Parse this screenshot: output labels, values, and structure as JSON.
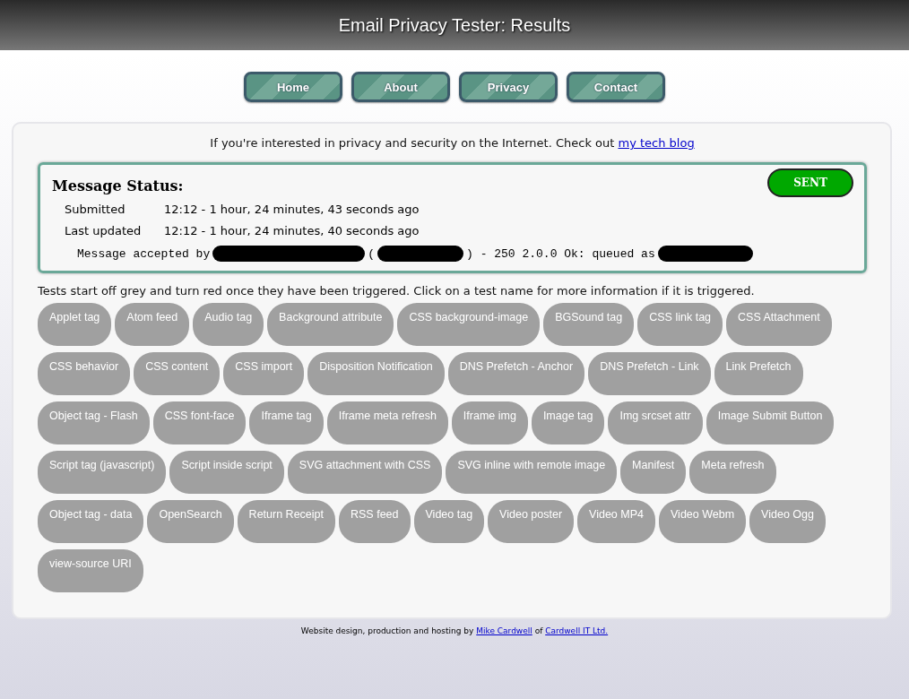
{
  "header": {
    "title": "Email Privacy Tester: Results"
  },
  "nav": [
    {
      "label": "Home"
    },
    {
      "label": "About"
    },
    {
      "label": "Privacy"
    },
    {
      "label": "Contact"
    }
  ],
  "intro": {
    "text": "If you're interested in privacy and security on the Internet. Check out",
    "link": "my tech blog"
  },
  "status": {
    "title": "Message Status:",
    "badge": "SENT",
    "rows": [
      {
        "label": "Submitted",
        "value": "12:12 - 1 hour, 24 minutes, 43 seconds ago"
      },
      {
        "label": "Last updated",
        "value": "12:12 - 1 hour, 24 minutes, 40 seconds ago"
      }
    ],
    "log": [
      {
        "kind": "text",
        "text": "Message accepted by"
      },
      {
        "kind": "redacted"
      },
      {
        "kind": "text",
        "text": "("
      },
      {
        "kind": "redacted"
      },
      {
        "kind": "text",
        "text": ") - 250 2.0.0 Ok: queued as"
      },
      {
        "kind": "redacted"
      }
    ]
  },
  "tests_intro": "Tests start off grey and turn red once they have been triggered. Click on a test name for more information if it is triggered.",
  "tests": [
    {
      "label": "Applet tag",
      "triggered": false
    },
    {
      "label": "Atom feed",
      "triggered": false
    },
    {
      "label": "Audio tag",
      "triggered": false
    },
    {
      "label": "Background attribute",
      "triggered": false
    },
    {
      "label": "CSS background-image",
      "triggered": false
    },
    {
      "label": "BGSound tag",
      "triggered": false
    },
    {
      "label": "CSS link tag",
      "triggered": false
    },
    {
      "label": "CSS Attachment",
      "triggered": false
    },
    {
      "label": "CSS behavior",
      "triggered": false
    },
    {
      "label": "CSS content",
      "triggered": false
    },
    {
      "label": "CSS import",
      "triggered": false
    },
    {
      "label": "Disposition Notification",
      "triggered": false
    },
    {
      "label": "DNS Prefetch - Anchor",
      "triggered": false
    },
    {
      "label": "DNS Prefetch - Link",
      "triggered": false
    },
    {
      "label": "Link Prefetch",
      "triggered": false
    },
    {
      "label": "Object tag - Flash",
      "triggered": false
    },
    {
      "label": "CSS font-face",
      "triggered": false
    },
    {
      "label": "Iframe tag",
      "triggered": false
    },
    {
      "label": "Iframe meta refresh",
      "triggered": false
    },
    {
      "label": "Iframe img",
      "triggered": false
    },
    {
      "label": "Image tag",
      "triggered": false
    },
    {
      "label": "Img srcset attr",
      "triggered": false
    },
    {
      "label": "Image Submit Button",
      "triggered": false
    },
    {
      "label": "Script tag (javascript)",
      "triggered": false
    },
    {
      "label": "Script inside script",
      "triggered": false
    },
    {
      "label": "SVG attachment with CSS",
      "triggered": false
    },
    {
      "label": "SVG inline with remote image",
      "triggered": false
    },
    {
      "label": "Manifest",
      "triggered": false
    },
    {
      "label": "Meta refresh",
      "triggered": false
    },
    {
      "label": "Object tag - data",
      "triggered": false
    },
    {
      "label": "OpenSearch",
      "triggered": false
    },
    {
      "label": "Return Receipt",
      "triggered": false
    },
    {
      "label": "RSS feed",
      "triggered": false
    },
    {
      "label": "Video tag",
      "triggered": false
    },
    {
      "label": "Video poster",
      "triggered": false
    },
    {
      "label": "Video MP4",
      "triggered": false
    },
    {
      "label": "Video Webm",
      "triggered": false
    },
    {
      "label": "Video Ogg",
      "triggered": false
    },
    {
      "label": "view-source URI",
      "triggered": false
    }
  ],
  "footer": {
    "text": "Website design, production and hosting by",
    "link1": "Mike Cardwell",
    "joiner": "of",
    "link2": "Cardwell IT Ltd."
  }
}
